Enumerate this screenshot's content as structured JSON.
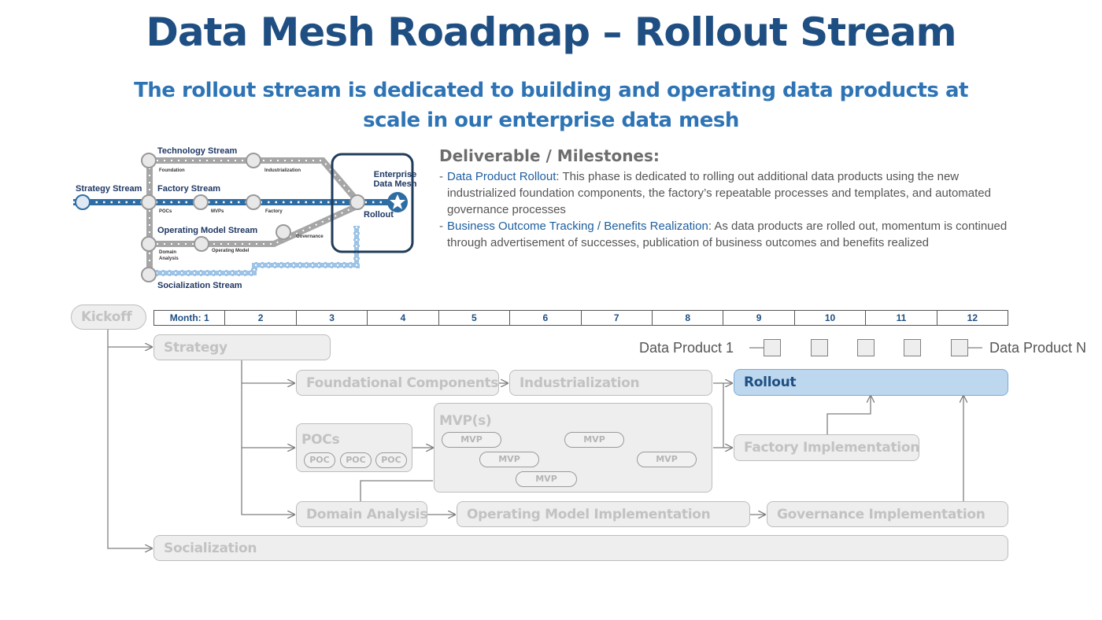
{
  "title": "Data Mesh Roadmap – Rollout Stream",
  "subtitle": "The rollout stream is dedicated to building and operating data products at scale in our enterprise data mesh",
  "metro": {
    "technology_stream": "Technology Stream",
    "strategy_stream": "Strategy Stream",
    "factory_stream": "Factory Stream",
    "operating_model_stream": "Operating Model Stream",
    "socialization_stream": "Socialization Stream",
    "enterprise_data_mesh_1": "Enterprise",
    "enterprise_data_mesh_2": "Data Mesh",
    "rollout": "Rollout",
    "foundation": "Foundation",
    "industrialization": "Industrialization",
    "pocs": "POCs",
    "mvps": "MVPs",
    "factory": "Factory",
    "governance": "Governance",
    "domain": "Domain",
    "analysis": "Analysis",
    "operating_model": "Operating Model",
    "colors": {
      "gray_line": "#a6a6a6",
      "blue_line": "#2e6da4",
      "light_blue_line": "#9dc3e6",
      "dark_border": "#1f3c5a"
    }
  },
  "deliverables": {
    "heading": "Deliverable / Milestones:",
    "items": [
      {
        "highlight": "Data Product Rollout",
        "text": ": This phase is dedicated to rolling out additional data products using the new industrialized foundation components, the factory’s repeatable processes and templates, and automated governance processes"
      },
      {
        "highlight": "Business Outcome Tracking / Benefits Realization",
        "text": ": As data products are rolled out, momentum is continued through advertisement of successes, publication of business outcomes and benefits realized"
      }
    ]
  },
  "timeline": {
    "kickoff": "Kickoff",
    "months": [
      "Month: 1",
      "2",
      "3",
      "4",
      "5",
      "6",
      "7",
      "8",
      "9",
      "10",
      "11",
      "12"
    ],
    "strategy": "Strategy",
    "data_product_first": "Data Product 1",
    "data_product_last": "Data Product N",
    "foundational_components": "Foundational Components",
    "industrialization": "Industrialization",
    "rollout": "Rollout",
    "pocs": "POCs",
    "poc": [
      "POC",
      "POC",
      "POC"
    ],
    "mvps": "MVP(s)",
    "mvp": [
      "MVP",
      "MVP",
      "MVP",
      "MVP",
      "MVP"
    ],
    "factory_implementation": "Factory Implementation",
    "domain_analysis": "Domain Analysis",
    "operating_model_implementation": "Operating Model Implementation",
    "governance_implementation": "Governance Implementation",
    "socialization": "Socialization",
    "colors": {
      "box_fill": "#eeeeee",
      "box_border": "#bdbdbd",
      "box_text": "#c2c2c2",
      "rollout_fill": "#bdd7ee",
      "rollout_text": "#1f4f82",
      "arrow": "#7f7f7f"
    }
  }
}
